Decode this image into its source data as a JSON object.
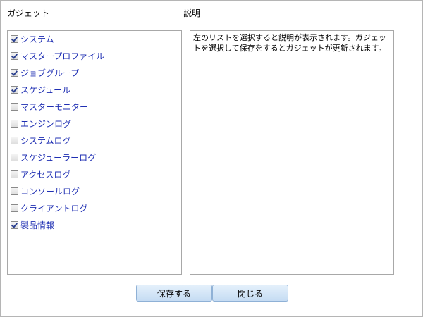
{
  "labels": {
    "gadgets": "ガジェット",
    "description": "説明"
  },
  "gadgets": [
    {
      "label": "システム",
      "checked": true
    },
    {
      "label": "マスタープロファイル",
      "checked": true
    },
    {
      "label": "ジョブグループ",
      "checked": true
    },
    {
      "label": "スケジュール",
      "checked": true
    },
    {
      "label": "マスターモニター",
      "checked": false
    },
    {
      "label": "エンジンログ",
      "checked": false
    },
    {
      "label": "システムログ",
      "checked": false
    },
    {
      "label": "スケジューラーログ",
      "checked": false
    },
    {
      "label": "アクセスログ",
      "checked": false
    },
    {
      "label": "コンソールログ",
      "checked": false
    },
    {
      "label": "クライアントログ",
      "checked": false
    },
    {
      "label": "製品情報",
      "checked": true
    }
  ],
  "description_text": "左のリストを選択すると説明が表示されます。ガジェットを選択して保存をするとガジェットが更新されます。",
  "buttons": {
    "save": "保存する",
    "close": "閉じる"
  },
  "colors": {
    "link_text": "#1f2fb3",
    "button_bg_top": "#e4f0fb",
    "button_bg_bottom": "#c5dcf3",
    "button_border": "#8fb1d6"
  }
}
